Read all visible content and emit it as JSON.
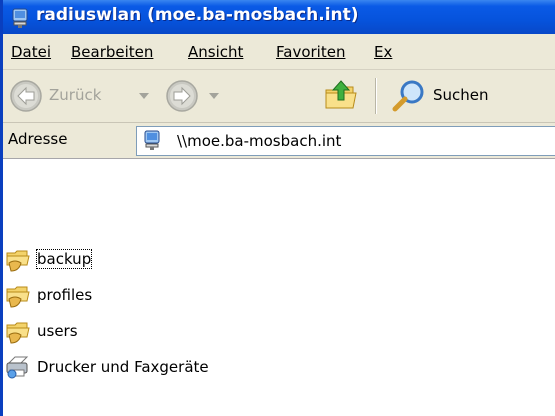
{
  "window": {
    "title": "radiuswlan (moe.ba-mosbach.int)",
    "accent": "#0653dc"
  },
  "menubar": {
    "items": [
      {
        "label": "Datei"
      },
      {
        "label": "Bearbeiten"
      },
      {
        "label": "Ansicht"
      },
      {
        "label": "Favoriten"
      },
      {
        "label": "Ex"
      }
    ]
  },
  "toolbar": {
    "back_label": "Zurück",
    "search_label": "Suchen"
  },
  "address": {
    "label": "Adresse",
    "value": "\\\\moe.ba-mosbach.int"
  },
  "content": {
    "items": [
      {
        "label": "backup",
        "icon": "shared-folder-icon"
      },
      {
        "label": "profiles",
        "icon": "shared-folder-icon"
      },
      {
        "label": "users",
        "icon": "shared-folder-icon"
      },
      {
        "label": "Drucker und Faxgeräte",
        "icon": "printers-folder-icon"
      }
    ]
  }
}
